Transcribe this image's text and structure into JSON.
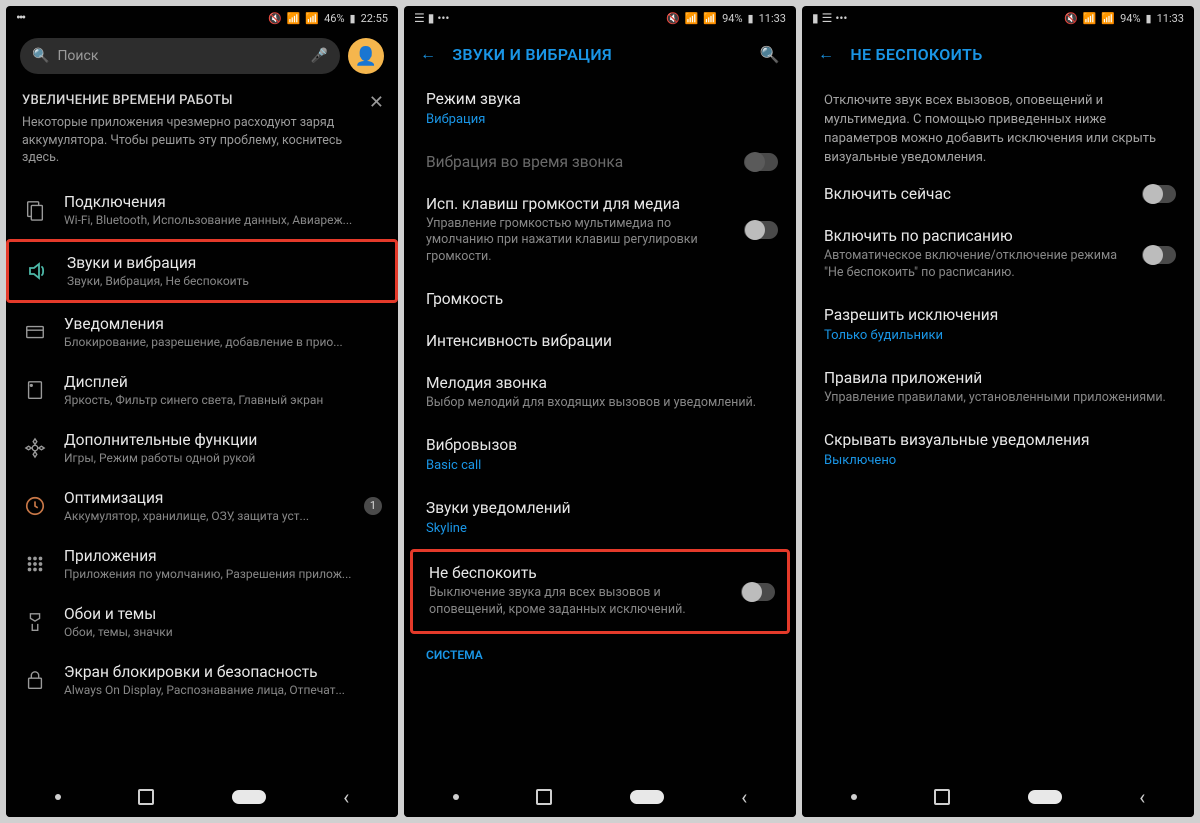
{
  "screen1": {
    "status": {
      "left_icon": "•••",
      "battery": "46%",
      "time": "22:55",
      "mute_icon": "🔇",
      "wifi_icon": "📶",
      "signal_icon": "▮"
    },
    "search_placeholder": "Поиск",
    "banner": {
      "title": "УВЕЛИЧЕНИЕ ВРЕМЕНИ РАБОТЫ",
      "text": "Некоторые приложения чрезмерно расходуют заряд аккумулятора. Чтобы решить эту проблему, коснитесь здесь."
    },
    "items": [
      {
        "title": "Подключения",
        "sub": "Wi-Fi, Bluetooth, Использование данных, Авиареж...",
        "icon": "connections"
      },
      {
        "title": "Звуки и вибрация",
        "sub": "Звуки, Вибрация, Не беспокоить",
        "icon": "sound",
        "highlight": true
      },
      {
        "title": "Уведомления",
        "sub": "Блокирование, разрешение, добавление в прио...",
        "icon": "notifications"
      },
      {
        "title": "Дисплей",
        "sub": "Яркость, Фильтр синего света, Главный экран",
        "icon": "display"
      },
      {
        "title": "Дополнительные функции",
        "sub": "Игры, Режим работы одной рукой",
        "icon": "advanced"
      },
      {
        "title": "Оптимизация",
        "sub": "Аккумулятор, хранилище, ОЗУ, защита уст...",
        "icon": "maintenance",
        "badge": "1"
      },
      {
        "title": "Приложения",
        "sub": "Приложения по умолчанию, Разрешения прилож...",
        "icon": "apps"
      },
      {
        "title": "Обои и темы",
        "sub": "Обои, темы, значки",
        "icon": "wallpaper"
      },
      {
        "title": "Экран блокировки и безопасность",
        "sub": "Always On Display, Распознавание лица, Отпечат...",
        "icon": "lock"
      }
    ]
  },
  "screen2": {
    "status": {
      "left_icon": "☰ ▮ •••",
      "battery": "94%",
      "time": "11:33"
    },
    "header": "ЗВУКИ И ВИБРАЦИЯ",
    "items": [
      {
        "title": "Режим звука",
        "sub": "Вибрация",
        "sub_blue": true
      },
      {
        "title": "Вибрация во время звонка",
        "dim": true,
        "toggle": true,
        "toggle_dim": true
      },
      {
        "title": "Исп. клавиш громкости для медиа",
        "sub": "Управление громкостью мультимедиа по умолчанию при нажатии клавиш регулировки громкости.",
        "toggle": true
      },
      {
        "title": "Громкость"
      },
      {
        "title": "Интенсивность вибрации"
      },
      {
        "title": "Мелодия звонка",
        "sub": "Выбор мелодий для входящих вызовов и уведомлений."
      },
      {
        "title": "Вибровызов",
        "sub": "Basic call",
        "sub_blue": true
      },
      {
        "title": "Звуки уведомлений",
        "sub": "Skyline",
        "sub_blue": true
      },
      {
        "title": "Не беспокоить",
        "sub": "Выключение звука для всех вызовов и оповещений, кроме заданных исключений.",
        "toggle": true,
        "highlight": true
      }
    ],
    "section_label": "СИСТЕМА"
  },
  "screen3": {
    "status": {
      "left_icon": "▮ ☰ •••",
      "battery": "94%",
      "time": "11:33"
    },
    "header": "НЕ БЕСПОКОИТЬ",
    "intro": "Отключите звук всех вызовов, оповещений и мультимедиа. С помощью приведенных ниже параметров можно добавить исключения или скрыть визуальные уведомления.",
    "items": [
      {
        "title": "Включить сейчас",
        "toggle": true
      },
      {
        "title": "Включить по расписанию",
        "sub": "Автоматическое включение/отключение режима \"Не беспокоить\" по расписанию.",
        "toggle": true
      },
      {
        "title": "Разрешить исключения",
        "sub": "Только будильники",
        "sub_blue": true
      },
      {
        "title": "Правила приложений",
        "sub": "Управление правилами, установленными приложениями."
      },
      {
        "title": "Скрывать визуальные уведомления",
        "sub": "Выключено",
        "sub_blue": true
      }
    ]
  }
}
